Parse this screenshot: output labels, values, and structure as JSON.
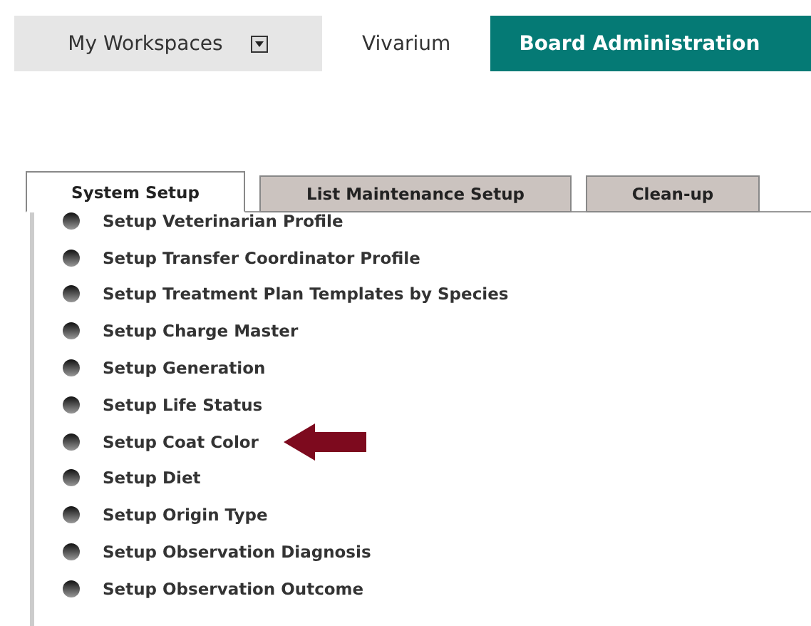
{
  "nav": [
    {
      "label": "My Workspaces",
      "kind": "dropdown",
      "selected": false
    },
    {
      "label": "Vivarium",
      "kind": "plain",
      "selected": false
    },
    {
      "label": "Board Administration",
      "kind": "plain",
      "selected": true
    }
  ],
  "tabs": [
    {
      "label": "System Setup",
      "selected": true
    },
    {
      "label": "List Maintenance Setup",
      "selected": false
    },
    {
      "label": "Clean-up",
      "selected": false
    }
  ],
  "items": [
    {
      "label": "Setup Veterinarian Profile",
      "arrow": false
    },
    {
      "label": "Setup Transfer Coordinator Profile",
      "arrow": false
    },
    {
      "label": "Setup Treatment Plan Templates by Species",
      "arrow": false
    },
    {
      "label": "Setup Charge Master",
      "arrow": false
    },
    {
      "label": "Setup Generation",
      "arrow": false
    },
    {
      "label": "Setup Life Status",
      "arrow": false
    },
    {
      "label": "Setup Coat Color",
      "arrow": true
    },
    {
      "label": "Setup Diet",
      "arrow": false
    },
    {
      "label": "Setup Origin Type",
      "arrow": false
    },
    {
      "label": "Setup Observation Diagnosis",
      "arrow": false
    },
    {
      "label": "Setup Observation Outcome",
      "arrow": false
    }
  ]
}
